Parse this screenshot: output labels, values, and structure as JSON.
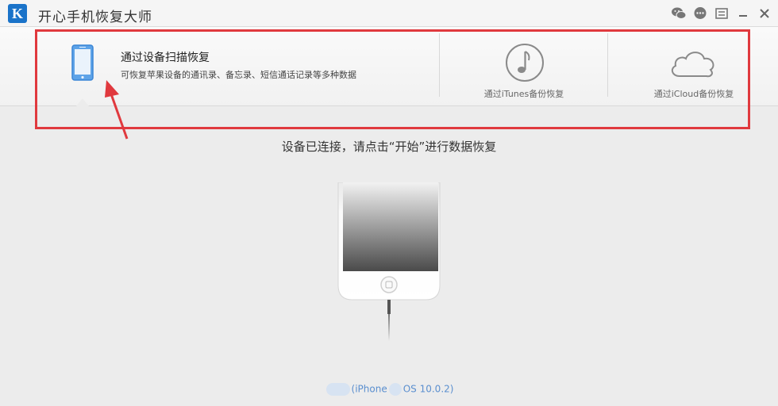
{
  "window": {
    "logo_letter": "K",
    "title": "开心手机恢复大师"
  },
  "modes": {
    "scan": {
      "title": "通过设备扫描恢复",
      "description": "可恢复苹果设备的通讯录、备忘录、短信通话记录等多种数据"
    },
    "itunes": {
      "label": "通过iTunes备份恢复"
    },
    "icloud": {
      "label": "通过iCloud备份恢复"
    }
  },
  "status": {
    "message": "设备已连接，请点击“开始”进行数据恢复"
  },
  "device": {
    "model": "(iPhone",
    "os": "OS 10.0.2)"
  },
  "colors": {
    "accent": "#1a73c9",
    "annotation": "#e0393e",
    "device_text": "#5b8fcf"
  },
  "icons": {
    "wechat": "wechat-icon",
    "chat": "chat-bubble-icon",
    "menu": "menu-icon",
    "minimize": "minimize-icon",
    "close": "close-icon"
  }
}
